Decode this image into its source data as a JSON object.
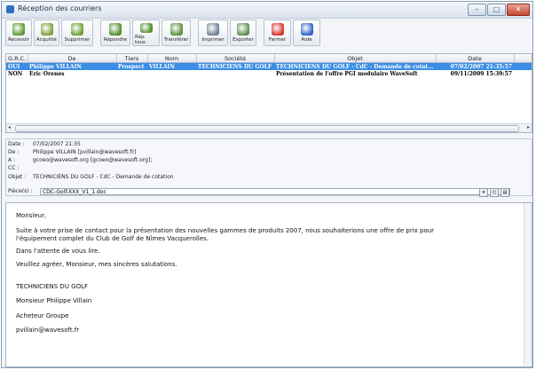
{
  "window": {
    "title": "Réception des courriers"
  },
  "toolbar": {
    "buttons": [
      {
        "label": "Recevoir",
        "color": "#5a9a2e"
      },
      {
        "label": "Acquitté",
        "color": "#7aa03a"
      },
      {
        "label": "Supprimer",
        "color": "#6e9e30"
      },
      {
        "label": "Répondre",
        "color": "#4f8f2a"
      },
      {
        "label": "Rép. tous",
        "color": "#4f8f2a"
      },
      {
        "label": "Transférer",
        "color": "#5a8f3a"
      },
      {
        "label": "Imprimer",
        "color": "#6d7f92"
      },
      {
        "label": "Exporter",
        "color": "#5d8f50"
      },
      {
        "label": "Fermer",
        "color": "#d8322a"
      },
      {
        "label": "Aide",
        "color": "#2f63c8"
      }
    ]
  },
  "grid": {
    "columns": [
      "G.R.C.",
      "De",
      "Tiers",
      "Nom",
      "Société",
      "Objet",
      "Date",
      "Tai"
    ],
    "rows": [
      [
        "OUI",
        "Philippe VILLAIN",
        "Prospect",
        "VILLAIN",
        "TECHNICIENS DU GOLF",
        "TECHNICIENS DU GOLF - CdC - Demande de cotat...",
        "07/02/2007 21:35:57",
        ""
      ],
      [
        "NON",
        "Eric Orenes",
        "",
        "",
        "",
        "Présentation de l'offre PGI modulaire WaveSoft",
        "09/11/2009 15:39:57",
        ""
      ]
    ],
    "selected_row": 0
  },
  "details": {
    "date_label": "Date :",
    "date_value": "07/02/2007 21:35",
    "from_label": "De :",
    "from_value": "Philippe VILLAIN [pvillain@wavesoft.fr]",
    "to_label": "A :",
    "to_value": "gcoeo@wavesoft.org [gcoeo@wavesoft.org];",
    "cc_label": "CC :",
    "cc_value": "",
    "subject_label": "Objet :",
    "subject_value": "TECHNICIENS DU GOLF - CdC - Demande de cotation",
    "attach_label": "Pièce(s) :",
    "attach_value": "CDC-Golf-XXX_V1_1.doc"
  },
  "message": {
    "greeting": "Monsieur,",
    "p1a": "Suite à votre prise de contact pour la présentation des nouvelles gammes de produits 2007, nous souhaiterions une offre de prix pour",
    "p1b": "l'équipement complet du Club de Golf de Nîmes Vacquerolles.",
    "p2": "Dans l'attente de vous lire.",
    "p3": "Veuillez agréer, Monsieur, mes sincères salutations.",
    "sig1": "TECHNICIENS DU GOLF",
    "sig2": "Monsieur Philippe Villain",
    "sig3": "Acheteur Groupe",
    "sig4": "pvillain@wavesoft.fr"
  }
}
